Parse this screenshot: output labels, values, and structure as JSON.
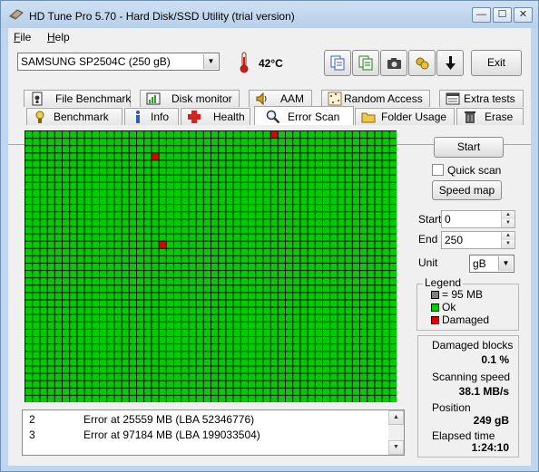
{
  "window": {
    "title": "HD Tune Pro 5.70 - Hard Disk/SSD Utility (trial version)",
    "controls": {
      "minimize": "—",
      "maximize": "☐",
      "close": "✕"
    }
  },
  "menu": {
    "file": "File",
    "help": "Help"
  },
  "toolbar": {
    "drive": "SAMSUNG SP2504C (250 gB)",
    "temperature": "42°C",
    "exit_label": "Exit",
    "icons": [
      "copy-icon",
      "save-icon",
      "camera-icon",
      "options-icon",
      "download-icon"
    ]
  },
  "tabs_top": [
    {
      "label": "File Benchmark",
      "icon": "file-benchmark-icon"
    },
    {
      "label": "Disk monitor",
      "icon": "disk-monitor-icon"
    },
    {
      "label": "AAM",
      "icon": "speaker-icon"
    },
    {
      "label": "Random Access",
      "icon": "random-access-icon"
    },
    {
      "label": "Extra tests",
      "icon": "extra-tests-icon"
    }
  ],
  "tabs_bottom": [
    {
      "label": "Benchmark",
      "icon": "benchmark-icon"
    },
    {
      "label": "Info",
      "icon": "info-icon"
    },
    {
      "label": "Health",
      "icon": "health-icon"
    },
    {
      "label": "Error Scan",
      "icon": "magnifier-icon",
      "active": true
    },
    {
      "label": "Folder Usage",
      "icon": "folder-icon"
    },
    {
      "label": "Erase",
      "icon": "trash-icon"
    }
  ],
  "scan_grid": {
    "columns": 50,
    "rows": 37,
    "ok_color": "#00cc00",
    "damaged_color": "#dd0000",
    "damaged_blocks": [
      [
        33,
        0
      ],
      [
        17,
        3
      ],
      [
        18,
        15
      ]
    ]
  },
  "controls": {
    "start_button": "Start",
    "quick_scan": "Quick scan",
    "quick_scan_checked": false,
    "speed_map_button": "Speed map",
    "start_label": "Start",
    "start_value": "0",
    "end_label": "End",
    "end_value": "250",
    "unit_label": "Unit",
    "unit_value": "gB"
  },
  "legend": {
    "title": "Legend",
    "block_size": "= 95 MB",
    "ok": "Ok",
    "damaged": "Damaged",
    "block_color": "#808080",
    "ok_color": "#00cc00",
    "damaged_color": "#dd0000"
  },
  "stats": {
    "damaged_blocks_label": "Damaged blocks",
    "damaged_blocks_value": "0.1 %",
    "scanning_speed_label": "Scanning speed",
    "scanning_speed_value": "38.1 MB/s",
    "position_label": "Position",
    "position_value": "249 gB",
    "elapsed_label": "Elapsed time",
    "elapsed_value": "1:24:10"
  },
  "log": [
    {
      "num": "2",
      "text": "Error at 25559 MB (LBA 52346776)"
    },
    {
      "num": "3",
      "text": "Error at 97184 MB (LBA 199033504)"
    }
  ]
}
